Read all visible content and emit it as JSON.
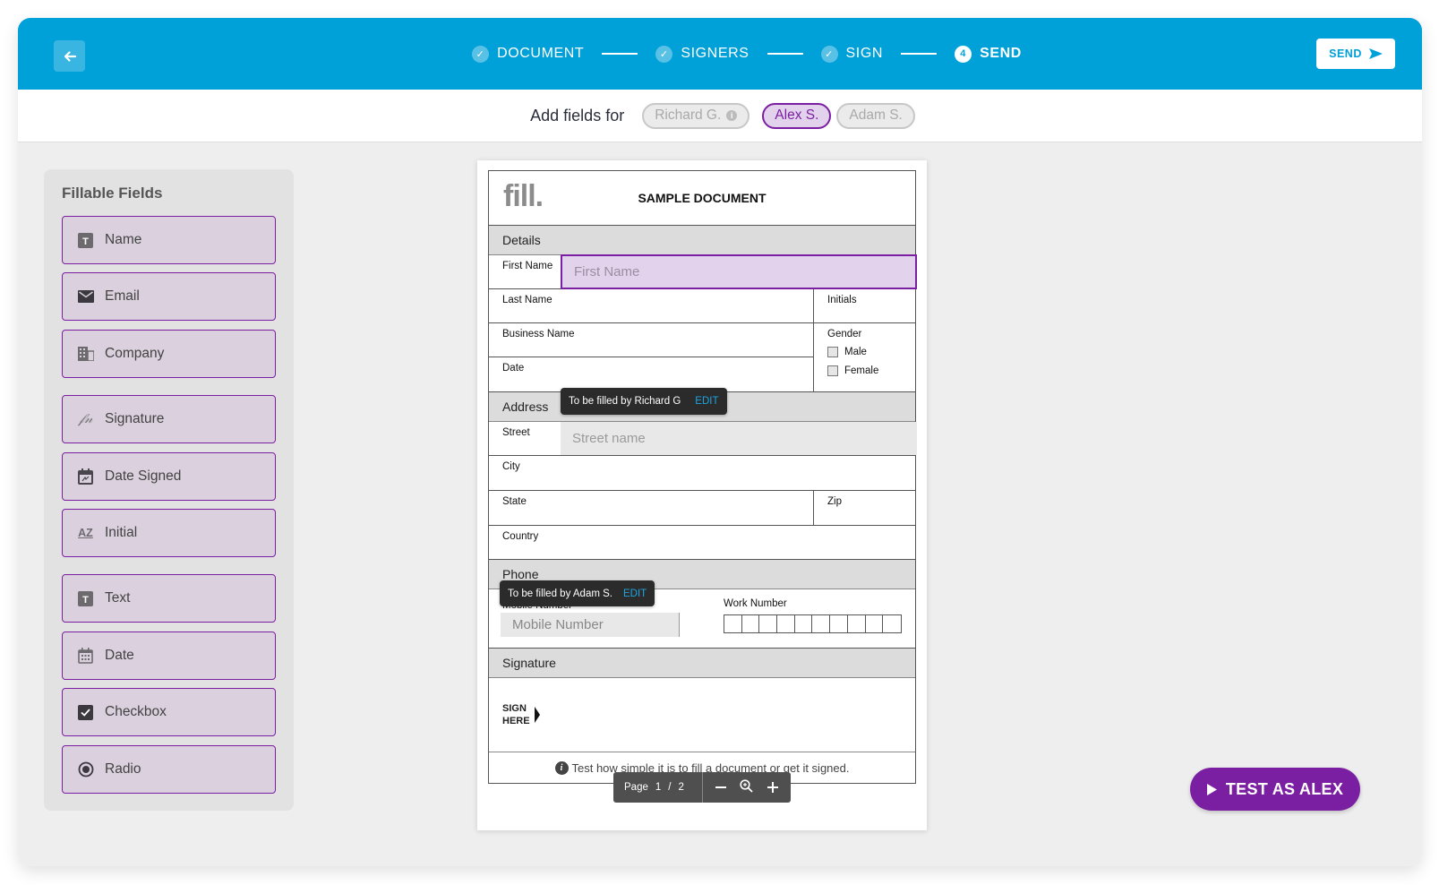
{
  "header": {
    "back_label": "Back",
    "steps": [
      {
        "label": "DOCUMENT",
        "state": "done",
        "marker": "✓"
      },
      {
        "label": "SIGNERS",
        "state": "done",
        "marker": "✓"
      },
      {
        "label": "SIGN",
        "state": "done",
        "marker": "✓"
      },
      {
        "label": "SEND",
        "state": "active",
        "marker": "4"
      }
    ],
    "send_label": "SEND",
    "brand_color": "#00a0d9"
  },
  "signer_bar": {
    "title": "Add fields for",
    "signers": [
      {
        "name": "Richard G.",
        "state": "disabled",
        "has_info": true
      },
      {
        "name": "Alex S.",
        "state": "active"
      },
      {
        "name": "Adam S.",
        "state": "disabled"
      }
    ],
    "accent_color": "#7b1fa2"
  },
  "sidebar": {
    "title": "Fillable Fields",
    "items": [
      {
        "label": "Name",
        "icon": "text-icon"
      },
      {
        "label": "Email",
        "icon": "envelope-icon"
      },
      {
        "label": "Company",
        "icon": "building-icon"
      },
      {
        "label": "Signature",
        "icon": "signature-icon"
      },
      {
        "label": "Date Signed",
        "icon": "calendar-sign-icon"
      },
      {
        "label": "Initial",
        "icon": "initials-icon"
      },
      {
        "label": "Text",
        "icon": "text-icon"
      },
      {
        "label": "Date",
        "icon": "calendar-icon"
      },
      {
        "label": "Checkbox",
        "icon": "checkbox-icon"
      },
      {
        "label": "Radio",
        "icon": "radio-icon"
      }
    ]
  },
  "document": {
    "logo": "fill.",
    "title": "SAMPLE DOCUMENT",
    "sections": {
      "details": "Details",
      "address": "Address",
      "phone": "Phone",
      "signature": "Signature"
    },
    "labels": {
      "first_name": "First Name",
      "last_name": "Last Name",
      "initials": "Initials",
      "business_name": "Business Name",
      "gender": "Gender",
      "male": "Male",
      "female": "Female",
      "date": "Date",
      "street": "Street",
      "city": "City",
      "state": "State",
      "zip": "Zip",
      "country": "Country",
      "mobile_number": "Mobile Number",
      "work_number": "Work Number",
      "sign_here_1": "SIGN",
      "sign_here_2": "HERE"
    },
    "placeholders": {
      "first_name": "First Name",
      "street": "Street name",
      "mobile_number": "Mobile Number"
    },
    "tooltips": {
      "richard": "To be filled by Richard G",
      "adam": "To be filled by Adam S.",
      "edit": "EDIT"
    },
    "footer_note": "Test how simple it is to fill a document or get it signed."
  },
  "pager": {
    "page_label": "Page",
    "current": "1",
    "separator": "/",
    "total": "2"
  },
  "test_button": {
    "label": "TEST AS ALEX"
  }
}
